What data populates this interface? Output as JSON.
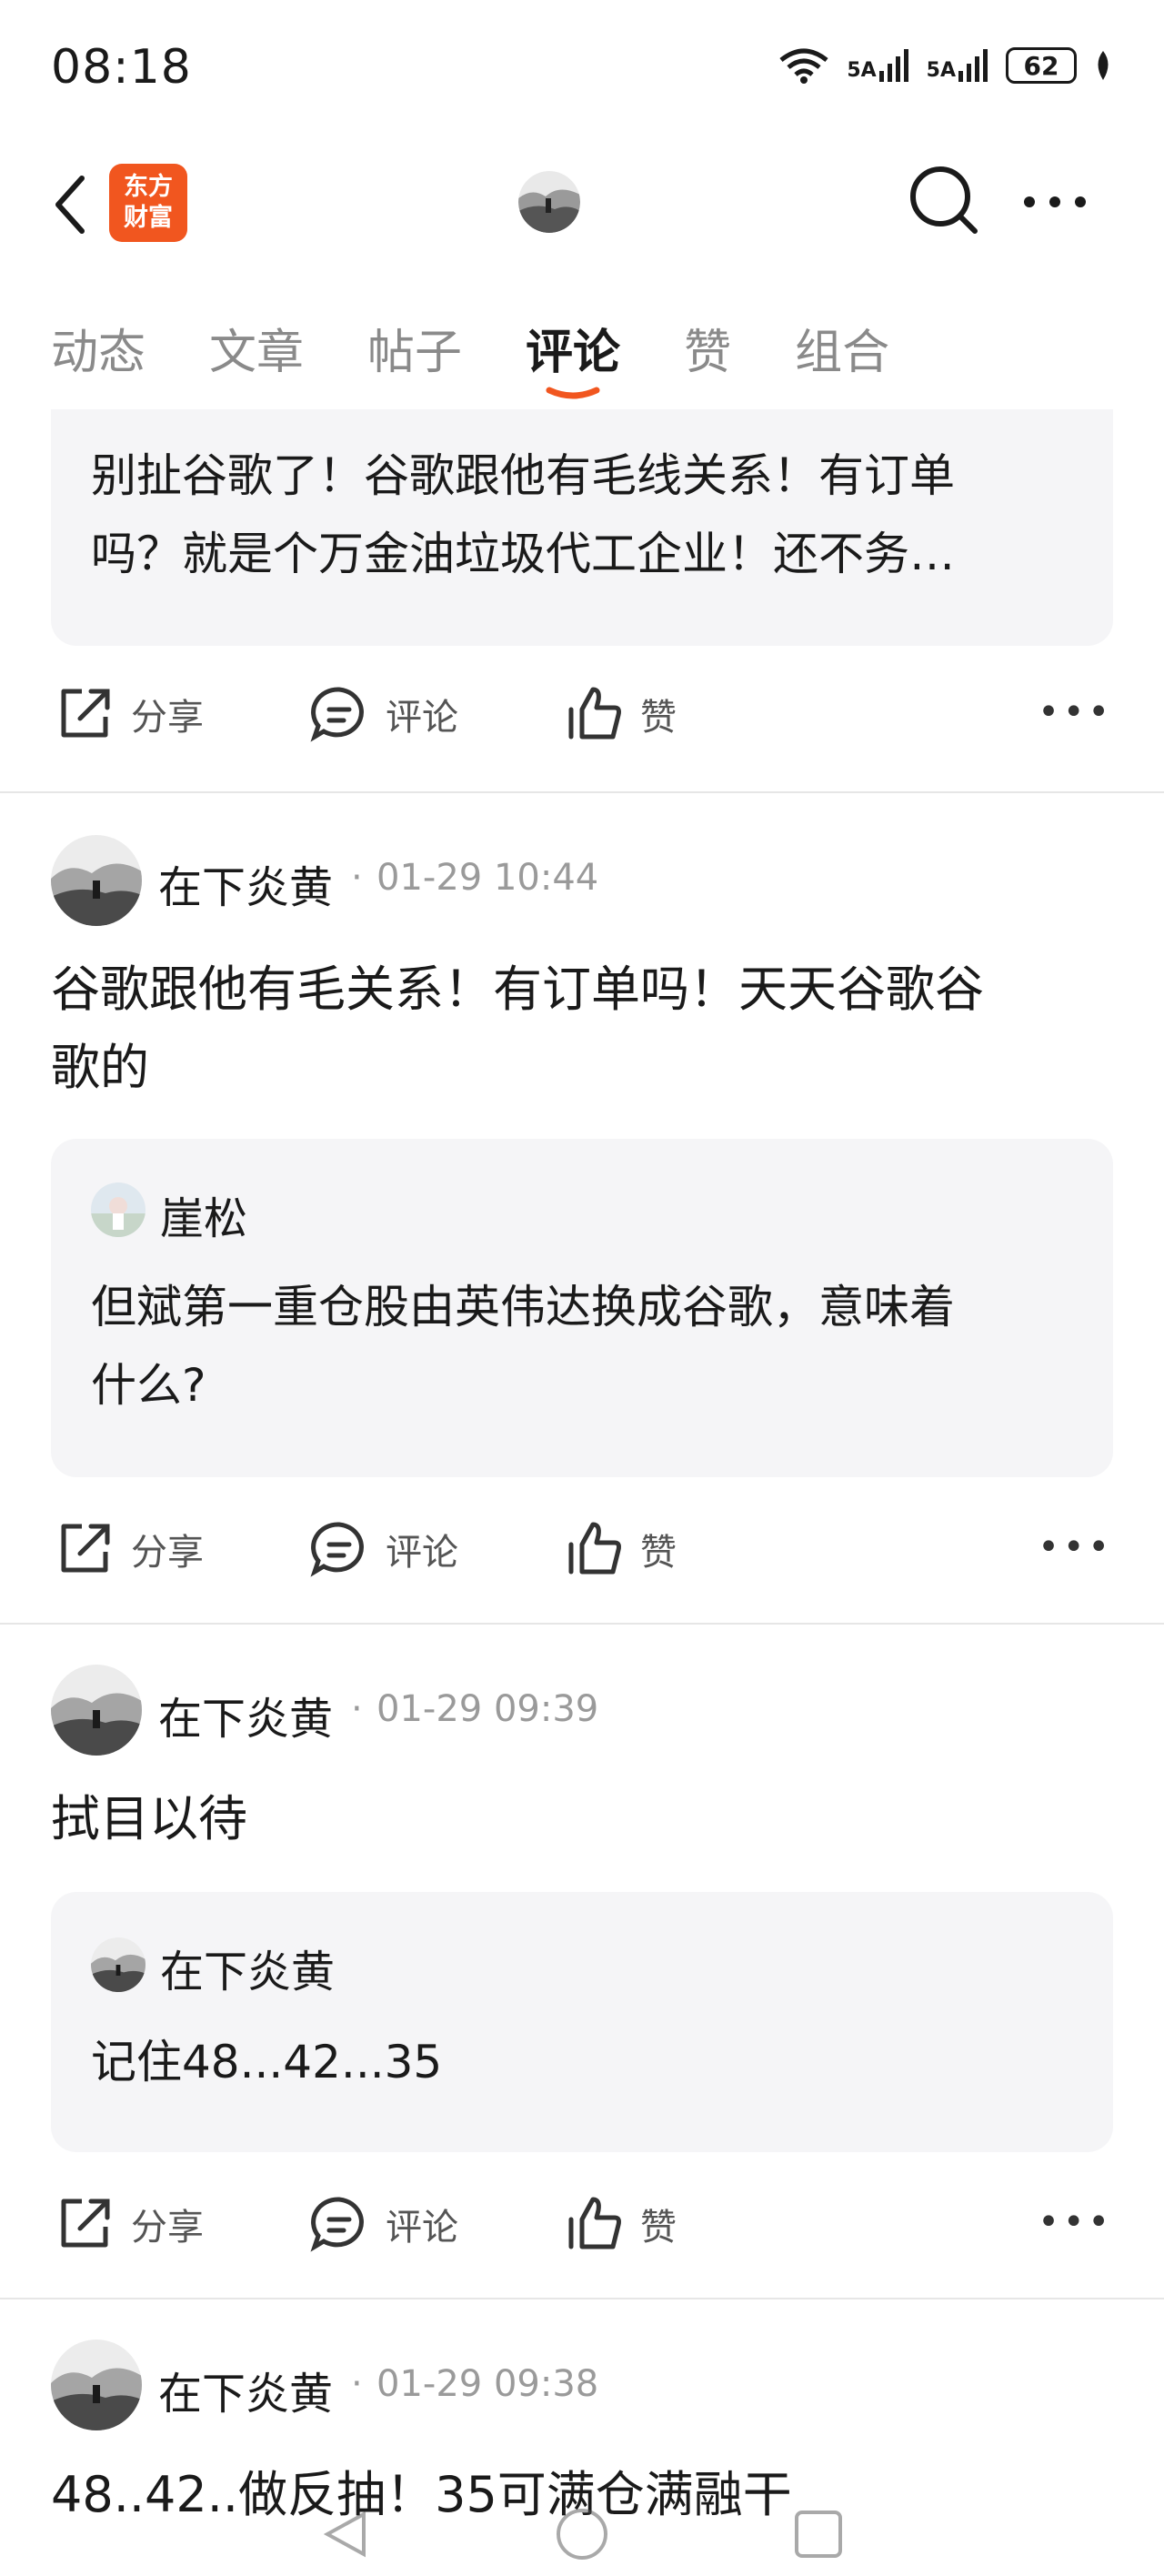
{
  "status": {
    "time": "08:18",
    "signal1": "5A",
    "signal2": "5A",
    "battery": "62"
  },
  "header": {
    "logo_line1": "东方",
    "logo_line2": "财富"
  },
  "tabs": [
    {
      "label": "动态",
      "active": false
    },
    {
      "label": "文章",
      "active": false
    },
    {
      "label": "帖子",
      "active": false
    },
    {
      "label": "评论",
      "active": true
    },
    {
      "label": "赞",
      "active": false
    },
    {
      "label": "组合",
      "active": false
    }
  ],
  "actions": {
    "share": "分享",
    "comment": "评论",
    "like": "赞"
  },
  "posts": [
    {
      "quote_text_1": "别扯谷歌了！谷歌跟他有毛线关系！有订单",
      "quote_text_2": "吗？就是个万金油垃圾代工企业！还不务…"
    },
    {
      "user": "在下炎黄",
      "time": "01-29 10:44",
      "text_1": "谷歌跟他有毛关系！有订单吗！天天谷歌谷",
      "text_2": "歌的",
      "quote_user": "崖松",
      "quote_text_1": "但斌第一重仓股由英伟达换成谷歌，意味着",
      "quote_text_2": "什么?"
    },
    {
      "user": "在下炎黄",
      "time": "01-29 09:39",
      "text_1": "拭目以待",
      "quote_user": "在下炎黄",
      "quote_text_1": "记住48...42...35"
    },
    {
      "user": "在下炎黄",
      "time": "01-29 09:38",
      "text_1": "48..42..做反抽！35可满仓满融干"
    }
  ],
  "colors": {
    "brand": "#f1561f",
    "quote_bg": "#f5f5f7",
    "divider": "#e6e6e6"
  }
}
